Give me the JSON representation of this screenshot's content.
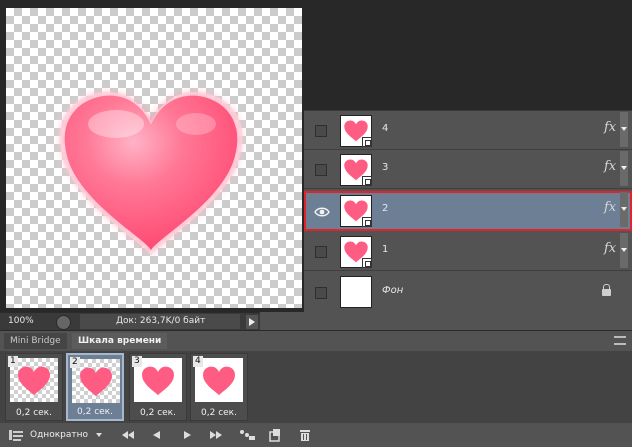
{
  "layers": {
    "items": [
      {
        "name": "4",
        "visible": false,
        "fx": "fx",
        "selected": false
      },
      {
        "name": "3",
        "visible": false,
        "fx": "fx",
        "selected": false
      },
      {
        "name": "2",
        "visible": true,
        "fx": "fx",
        "selected": true
      },
      {
        "name": "1",
        "visible": false,
        "fx": "fx",
        "selected": false
      },
      {
        "name": "Фон",
        "visible": false,
        "fx": "",
        "selected": false,
        "locked": true
      }
    ]
  },
  "status": {
    "zoom": "100%",
    "doc_info": "Док: 263,7K/0 байт"
  },
  "panel": {
    "tabs": [
      "Mini Bridge",
      "Шкала времени"
    ],
    "active_tab": "Шкала времени"
  },
  "timeline": {
    "frames": [
      {
        "number": "1",
        "delay": "0,2 сек.",
        "selected": false
      },
      {
        "number": "2",
        "delay": "0,2 сек.",
        "selected": true
      },
      {
        "number": "3",
        "delay": "0,2 сек.",
        "selected": false
      },
      {
        "number": "4",
        "delay": "0,2 сек.",
        "selected": false
      }
    ],
    "loop_option": "Однократно"
  },
  "icons": {
    "visibility": "eye-icon",
    "lock": "lock-icon",
    "fx": "fx-icon",
    "first_frame": "first-frame-icon",
    "prev_frame": "prev-frame-icon",
    "play": "play-icon",
    "next_frame": "next-frame-icon",
    "tween": "tween-icon",
    "duplicate": "duplicate-frame-icon",
    "delete": "trash-icon"
  },
  "colors": {
    "selection_highlight": "#e0242a",
    "selected_bg": "#6c7f95",
    "heart": "#ff4f7b"
  }
}
